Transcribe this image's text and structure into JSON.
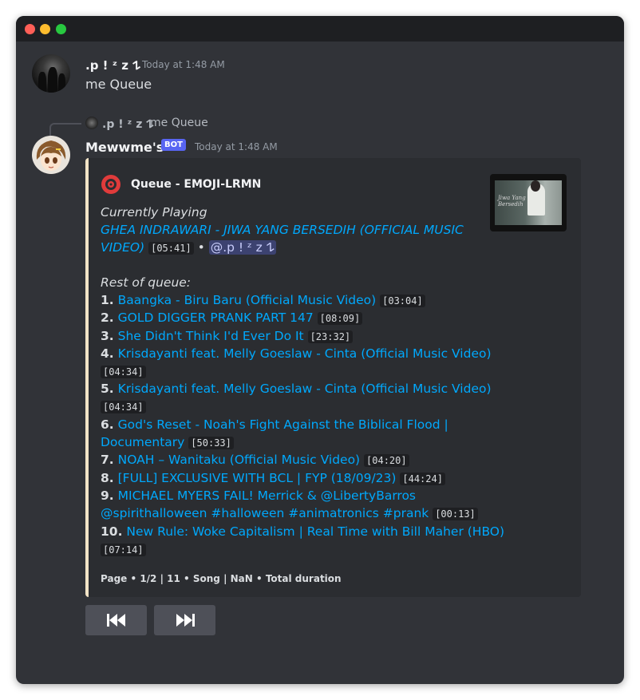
{
  "window": {
    "controls": [
      "close",
      "minimize",
      "maximize"
    ]
  },
  "message1": {
    "username": ".p ! ᶻ z 𐰁",
    "timestamp": "Today at 1:48 AM",
    "text": "me Queue"
  },
  "reply": {
    "username": ".p ! ᶻ z 𐰁",
    "text": "me Queue"
  },
  "message2": {
    "username": "Mewwme's",
    "bot_tag": "BOT",
    "timestamp": "Today at 1:48 AM"
  },
  "embed": {
    "accent_color": "#f2e3c6",
    "title": "Queue - EMOJI-LRMN",
    "current_heading": "Currently Playing",
    "current_title_line1": "GHEA INDRAWARI - JIWA YANG BERSEDIH (OFFICIAL MUSIC",
    "current_title_line2": "VIDEO)",
    "current_duration": "[05:41]",
    "current_separator": "•",
    "current_requester": "@.p ! ᶻ z 𐰁",
    "rest_heading": "Rest of queue:",
    "queue": [
      {
        "num": "1.",
        "title": "Baangka - Biru Baru (Official Music Video)",
        "duration": "[03:04]"
      },
      {
        "num": "2.",
        "title": "GOLD DIGGER PRANK PART 147",
        "duration": "[08:09]"
      },
      {
        "num": "3.",
        "title": "She Didn't Think I'd Ever Do It",
        "duration": "[23:32]"
      },
      {
        "num": "4.",
        "title": "Krisdayanti feat. Melly Goeslaw - Cinta (Official Music Video)",
        "duration": "[04:34]"
      },
      {
        "num": "5.",
        "title": "Krisdayanti feat. Melly Goeslaw - Cinta (Official Music Video)",
        "duration": "[04:34]"
      },
      {
        "num": "6.",
        "title_line1": "God's Reset - Noah's Fight Against the Biblical Flood |",
        "title_line2": "Documentary",
        "duration": "[50:33]"
      },
      {
        "num": "7.",
        "title": "NOAH – Wanitaku (Official Music Video)",
        "duration": "[04:20]"
      },
      {
        "num": "8.",
        "title": "[FULL] EXCLUSIVE WITH BCL | FYP (18/09/23)",
        "duration": "[44:24]"
      },
      {
        "num": "9.",
        "title_line1": "MICHAEL MYERS FAIL! Merrick & @LibertyBarros",
        "title_line2": "@spirithalloween #halloween #animatronics #prank",
        "duration": "[00:13]"
      },
      {
        "num": "10.",
        "title": "New Rule: Woke Capitalism | Real Time with Bill Maher (HBO)",
        "duration": "[07:14]"
      }
    ],
    "footer": "Page • 1/2 | 11 • Song | NaN • Total duration"
  },
  "buttons": {
    "previous_icon": "skip-previous-icon",
    "next_icon": "skip-next-icon"
  }
}
